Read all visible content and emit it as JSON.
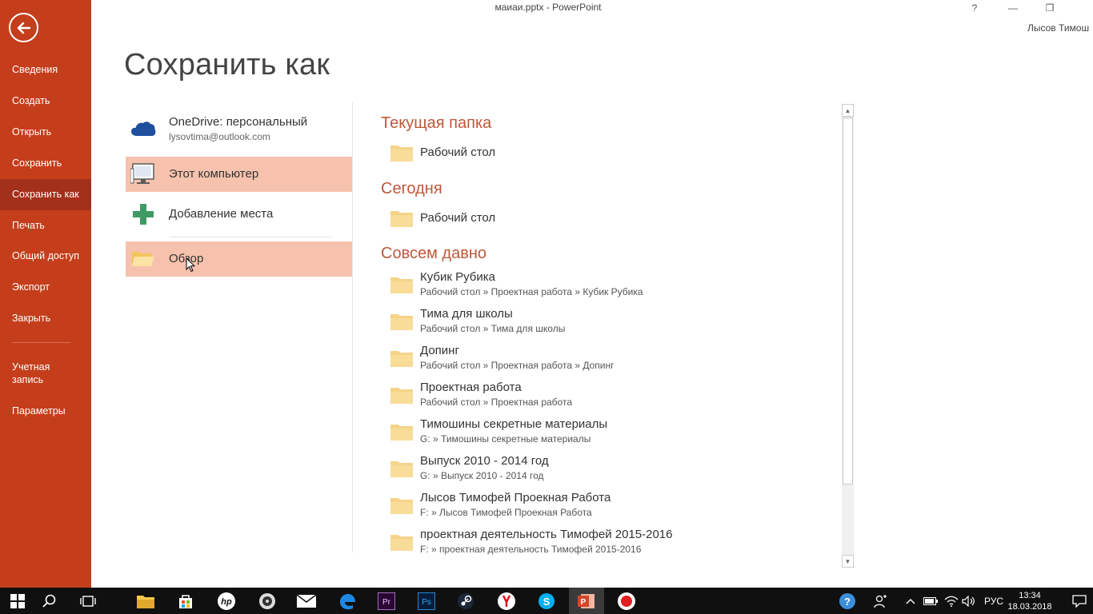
{
  "window": {
    "title": "маиаи.pptx - PowerPoint",
    "help_label": "?",
    "minimize_label": "—",
    "restore_label": "❐",
    "user_name": "Лысов Тимош"
  },
  "sidebar": {
    "items": [
      {
        "label": "Сведения"
      },
      {
        "label": "Создать"
      },
      {
        "label": "Открыть"
      },
      {
        "label": "Сохранить"
      },
      {
        "label": "Сохранить как"
      },
      {
        "label": "Печать"
      },
      {
        "label": "Общий доступ"
      },
      {
        "label": "Экспорт"
      },
      {
        "label": "Закрыть"
      },
      {
        "label": "Учетная запись"
      },
      {
        "label": "Параметры"
      }
    ],
    "active_item": "Сохранить как"
  },
  "page_title": "Сохранить как",
  "places": [
    {
      "label": "OneDrive: персональный",
      "sublabel": "lysovtima@outlook.com",
      "icon": "onedrive-icon"
    },
    {
      "label": "Этот компьютер",
      "icon": "computer-icon"
    },
    {
      "label": "Добавление места",
      "icon": "plus-icon"
    },
    {
      "label": "Обзор",
      "icon": "folder-open-icon"
    }
  ],
  "folders": {
    "current_heading": "Текущая папка",
    "current": [
      {
        "name": "Рабочий стол"
      }
    ],
    "today_heading": "Сегодня",
    "today": [
      {
        "name": "Рабочий стол"
      }
    ],
    "older_heading": "Совсем давно",
    "older": [
      {
        "name": "Кубик Рубика",
        "path": "Рабочий стол » Проектная работа » Кубик Рубика"
      },
      {
        "name": "Тима для школы",
        "path": "Рабочий стол » Тима для школы"
      },
      {
        "name": "Допинг",
        "path": "Рабочий стол » Проектная работа » Допинг"
      },
      {
        "name": "Проектная работа",
        "path": "Рабочий стол » Проектная работа"
      },
      {
        "name": "Тимошины секретные материалы",
        "path": "G: » Тимошины секретные материалы"
      },
      {
        "name": "Выпуск 2010 - 2014 год",
        "path": "G: » Выпуск 2010 - 2014 год"
      },
      {
        "name": "Лысов Тимофей Проекная Работа",
        "path": "F: » Лысов Тимофей Проекная Работа"
      },
      {
        "name": "проектная деятельность Тимофей 2015-2016",
        "path": "F: » проектная деятельность Тимофей 2015-2016"
      }
    ]
  },
  "taskbar": {
    "apps": [
      "start-icon",
      "search-icon",
      "task-view-icon",
      "file-explorer-icon",
      "store-icon",
      "hp-icon",
      "media-icon",
      "mail-icon",
      "edge-icon",
      "premiere-icon",
      "photoshop-icon",
      "steam-icon",
      "yandex-icon",
      "skype-icon",
      "powerpoint-icon",
      "record-icon"
    ],
    "language": "РУС",
    "time": "13:34",
    "date": "18.03.2018"
  },
  "colors": {
    "accent": "#c43e1c",
    "accent_dark": "#a3301a",
    "selected_place": "#f6c2ad",
    "heading": "#c0573a",
    "folder": "#f5d48a"
  }
}
